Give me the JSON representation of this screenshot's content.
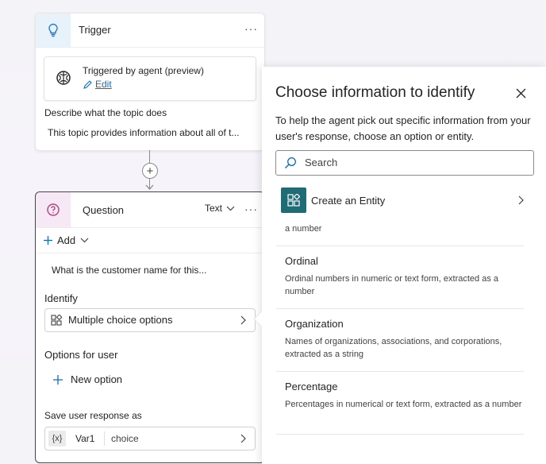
{
  "trigger": {
    "title": "Trigger",
    "more": "···",
    "triggered_by": "Triggered by agent (preview)",
    "edit_link": "Edit",
    "describe_label": "Describe what the topic does",
    "describe_value": "This topic provides information about all of t..."
  },
  "connector": {
    "add_symbol": "+"
  },
  "question": {
    "title": "Question",
    "type_label": "Text",
    "more": "···",
    "add_label": "Add",
    "prompt_text": "What is the customer name for this...",
    "identify_label": "Identify",
    "identify_value": "Multiple choice options",
    "options_label": "Options for user",
    "new_option_label": "New option",
    "save_label": "Save user response as",
    "var_badge": "{x}",
    "var_name": "Var1",
    "var_type": "choice"
  },
  "panel": {
    "title": "Choose information to identify",
    "description": "To help the agent pick out specific information from your user's response, choose an option or entity.",
    "search_placeholder": "Search",
    "create_entity_label": "Create an Entity",
    "partial_desc": "a number",
    "options": [
      {
        "title": "Ordinal",
        "desc": "Ordinal numbers in numeric or text form, extracted as a number"
      },
      {
        "title": "Organization",
        "desc": "Names of organizations, associations, and corporations, extracted as a string"
      },
      {
        "title": "Percentage",
        "desc": "Percentages in numerical or text form, extracted as a number"
      }
    ]
  },
  "colors": {
    "accent": "#0f6cbd",
    "entity_tile": "#1f6b76",
    "trigger_header": "#e8f2fb",
    "question_header": "#f6e8f4"
  }
}
